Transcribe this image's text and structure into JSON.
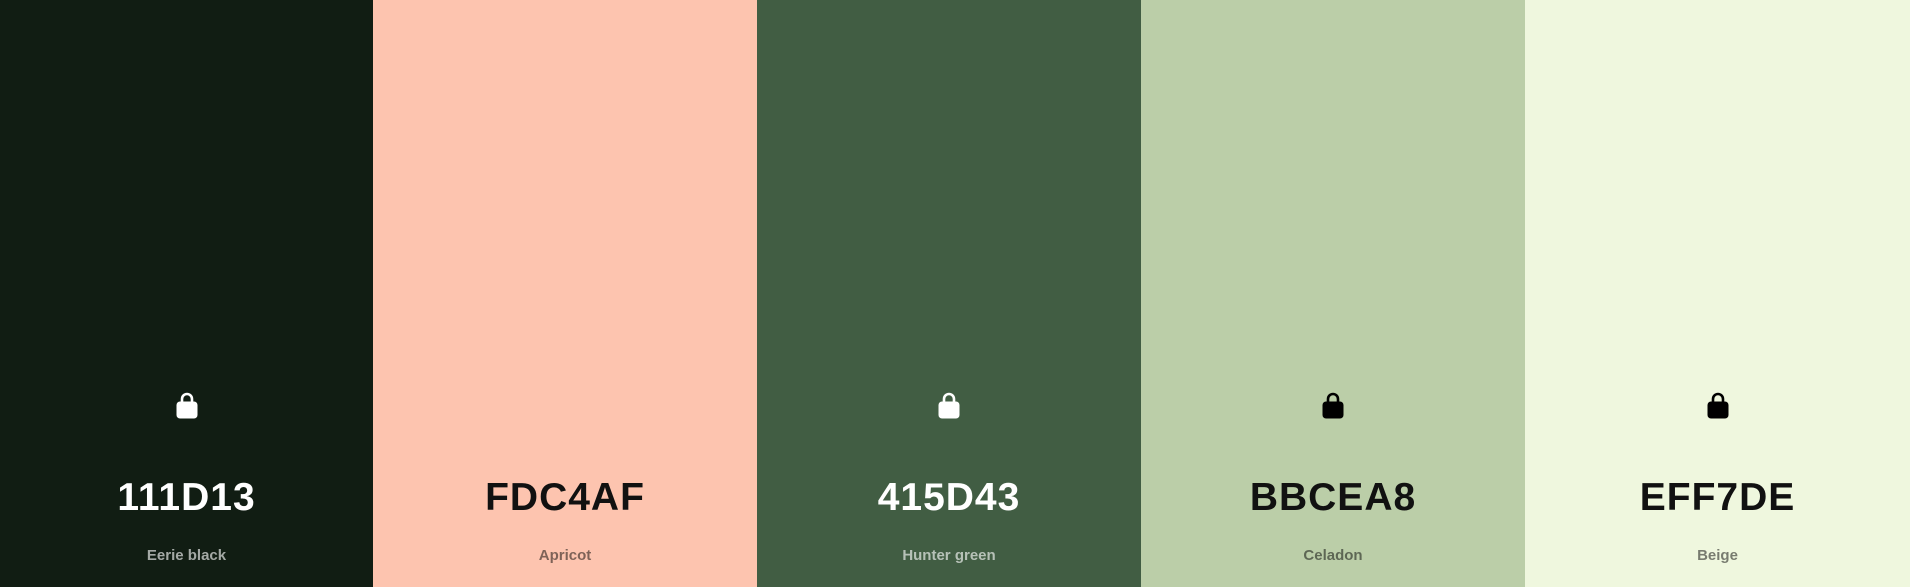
{
  "swatches": [
    {
      "hex": "111D13",
      "name": "Eerie black",
      "color": "#111D13",
      "tone": "dark",
      "show_lock": true,
      "lock_icon": "lock-icon"
    },
    {
      "hex": "FDC4AF",
      "name": "Apricot",
      "color": "#FDC4AF",
      "tone": "light",
      "show_lock": false,
      "lock_icon": "lock-icon"
    },
    {
      "hex": "415D43",
      "name": "Hunter green",
      "color": "#415D43",
      "tone": "dark",
      "show_lock": true,
      "lock_icon": "lock-icon"
    },
    {
      "hex": "BBCEA8",
      "name": "Celadon",
      "color": "#BBCEA8",
      "tone": "light",
      "show_lock": true,
      "lock_icon": "lock-icon"
    },
    {
      "hex": "EFF7DE",
      "name": "Beige",
      "color": "#EFF7DE",
      "tone": "light",
      "show_lock": true,
      "lock_icon": "lock-icon"
    }
  ]
}
